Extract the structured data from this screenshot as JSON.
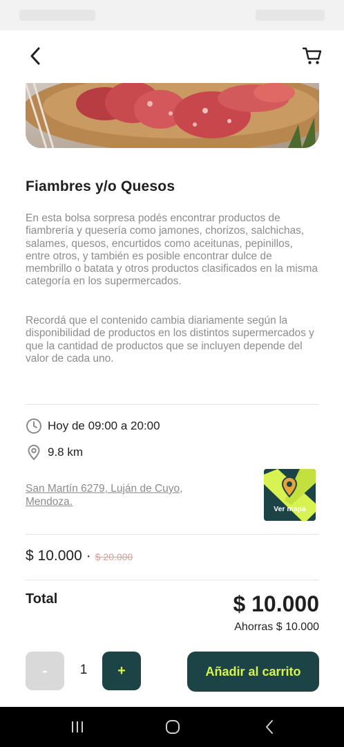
{
  "product": {
    "title": "Fiambres y/o Quesos",
    "description_1": "En esta bolsa sorpresa podés encontrar productos de fiambrería y quesería como jamones, chorizos, salchichas, salames, quesos, encurtidos como aceitunas, pepinillos, entre otros, y también es posible encontrar dulce de membrillo o batata y otros productos clasificados en la misma categoría en los supermercados.",
    "description_2": "Recordá que el contenido cambia diariamente según la disponibilidad de productos en los distintos supermercados y que la cantidad de productos que se incluyen depende del valor de cada uno."
  },
  "pickup": {
    "schedule": "Hoy de 09:00 a 20:00",
    "distance": "9.8 km",
    "address": "San Martín 6279, Luján de Cuyo, Mendoza.",
    "map_button_label": "Ver mapa"
  },
  "pricing": {
    "current_price": "$ 10.000",
    "separator": "·",
    "original_price": "$ 20.000",
    "total_label": "Total",
    "total_value": "$ 10.000",
    "savings_text": "Ahorras $ 10.000"
  },
  "cart_controls": {
    "minus_label": "-",
    "quantity": "1",
    "plus_label": "+",
    "add_to_cart_label": "Añadir al carrito"
  },
  "colors": {
    "brand_dark": "#1c4446",
    "brand_accent": "#d8f251",
    "old_price": "#e39a9a",
    "muted_text": "#8c8c8c"
  }
}
